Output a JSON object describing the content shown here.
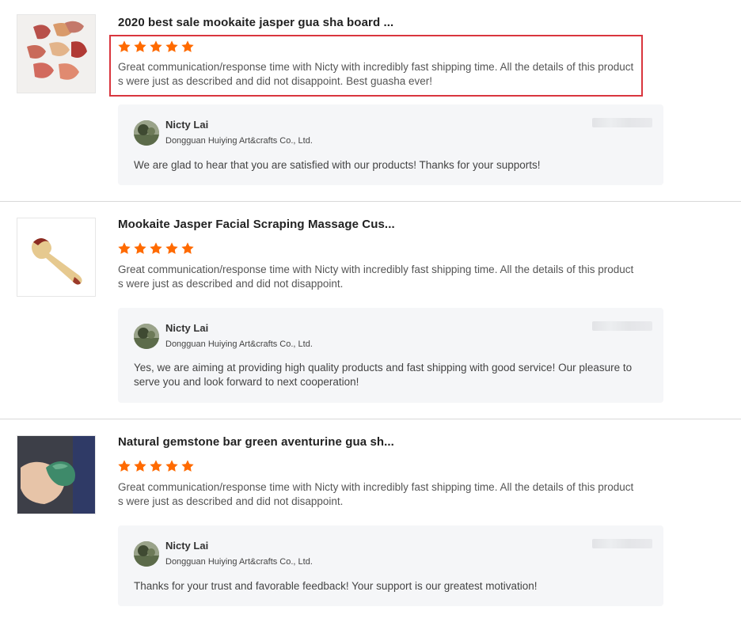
{
  "reviews": [
    {
      "title": "2020 best sale mookaite jasper gua sha board ...",
      "stars": 5,
      "text": "Great communication/response time with Nicty with incredibly fast shipping time.  All the details of this products were just as described and did not disappoint.  Best guasha ever!",
      "highlighted": true,
      "reply": {
        "name": "Nicty Lai",
        "company": "Dongguan Huiying Art&crafts Co., Ltd.",
        "text": "We are glad to hear that you are satisfied with our products! Thanks for your supports!"
      }
    },
    {
      "title": "Mookaite Jasper Facial Scraping Massage Cus...",
      "stars": 5,
      "text": "Great communication/response time with Nicty with incredibly fast shipping time.  All the details of this products were just as described and did not disappoint.",
      "highlighted": false,
      "reply": {
        "name": "Nicty Lai",
        "company": "Dongguan Huiying Art&crafts Co., Ltd.",
        "text": "Yes, we are aiming at providing high quality products and fast shipping with good service!  Our pleasure to serve you and look forward to next cooperation!"
      }
    },
    {
      "title": "Natural gemstone bar green aventurine gua sh...",
      "stars": 5,
      "text": "Great communication/response time with Nicty with incredibly fast shipping time.  All the details of this products were just as described and did not disappoint.",
      "highlighted": false,
      "reply": {
        "name": "Nicty Lai",
        "company": "Dongguan Huiying Art&crafts Co., Ltd.",
        "text": "Thanks for your trust and favorable feedback! Your support is our greatest motivation!"
      }
    }
  ],
  "colors": {
    "star": "#ff6a00",
    "highlight_border": "#d9363e",
    "reply_background": "#f5f6f8"
  },
  "icons": [
    "star-icon",
    "product-thumbnail",
    "seller-avatar"
  ]
}
